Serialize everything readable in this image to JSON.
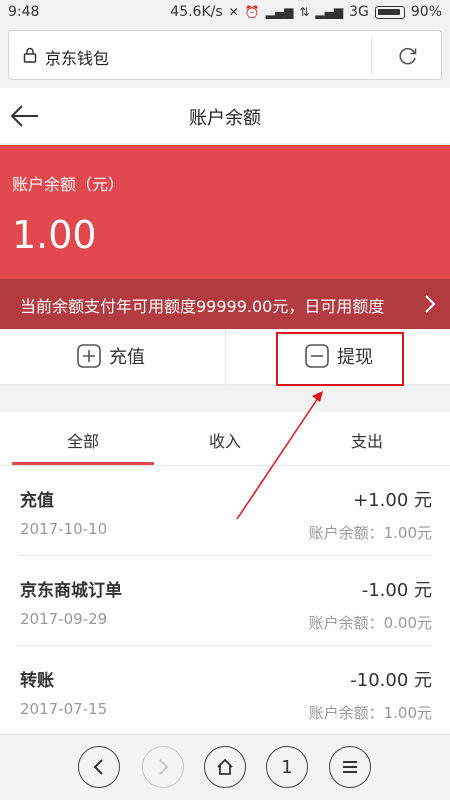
{
  "status_bar": {
    "time": "9:48",
    "speed": "45.6K/s",
    "network": "3G",
    "battery": "90%",
    "battery_level": 0.9
  },
  "browser": {
    "url_title": "京东钱包"
  },
  "header": {
    "title": "账户余额"
  },
  "balance": {
    "label": "账户余额（元）",
    "amount": "1.00",
    "notice": "当前余额支付年可用额度99999.00元，日可用额度"
  },
  "actions": {
    "recharge": "充值",
    "withdraw": "提现"
  },
  "tabs": [
    "全部",
    "收入",
    "支出"
  ],
  "transactions": [
    {
      "name": "充值",
      "date": "2017-10-10",
      "amount": "+1.00 元",
      "balance": "账户余额：1.00元"
    },
    {
      "name": "京东商城订单",
      "date": "2017-09-29",
      "amount": "-1.00 元",
      "balance": "账户余额：0.00元"
    },
    {
      "name": "转账",
      "date": "2017-07-15",
      "amount": "-10.00 元",
      "balance": "账户余额：1.00元"
    }
  ],
  "bottom_nav": {
    "tab_count": "1"
  },
  "colors": {
    "brand_red": "#e2494f",
    "notice_red": "#b23b3f",
    "annotation_red": "#e0131b"
  }
}
